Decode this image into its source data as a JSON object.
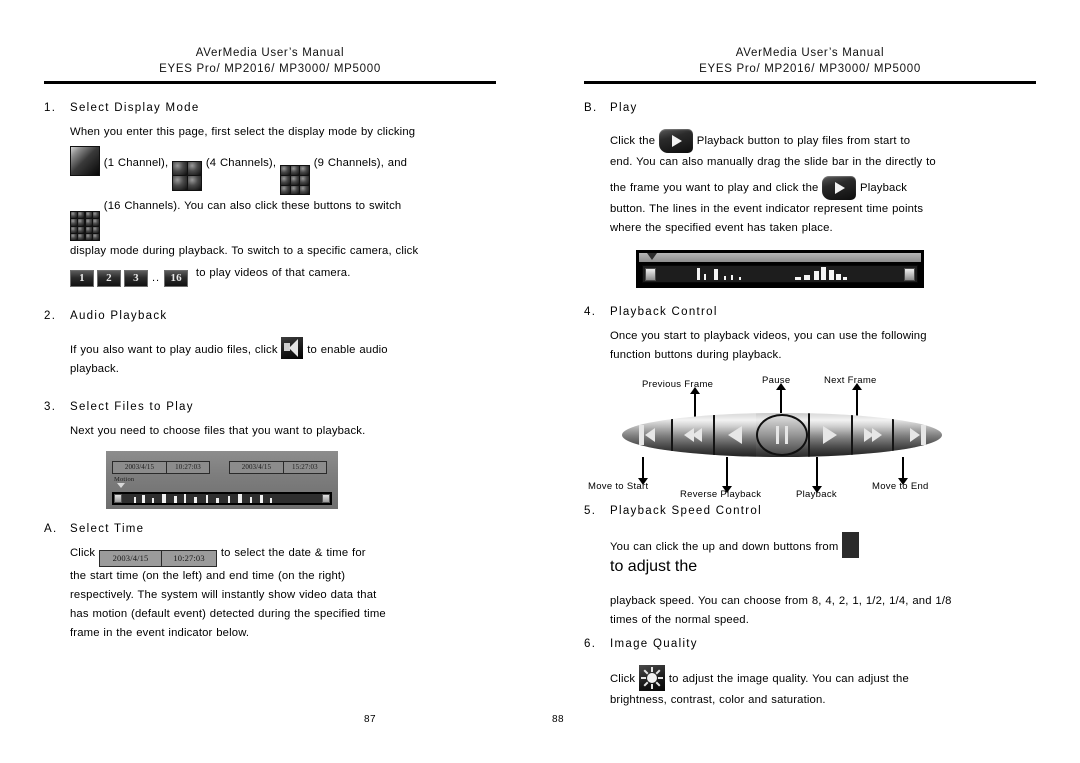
{
  "header": {
    "line1": "AVerMedia User’s Manual",
    "line2": "EYES Pro/ MP2016/ MP3000/ MP5000"
  },
  "left_page": {
    "page_number": "87",
    "sections": [
      {
        "marker": "1.",
        "heading": "Select Display Mode",
        "para1": "When you enter this page, first select the display mode by clicking",
        "label_1ch": "(1  Channel),",
        "label_4ch": "(4  Channels),",
        "label_9ch": "(9  Channels),  and",
        "label_16ch": "(16 Channels).   You  can  also  click  these  buttons  to  switch",
        "para2": "display  mode  during  playback.   To  switch  to  a  specific  camera,  click",
        "camera_buttons": [
          "1",
          "2",
          "3",
          "16"
        ],
        "camera_dots": "..",
        "para3": "to play videos of that camera."
      },
      {
        "marker": "2.",
        "heading": "Audio Playback",
        "para1_before": "If  you  also  want  to  play  audio  files,  click",
        "para1_after": "to  enable  audio",
        "para2": "playback."
      },
      {
        "marker": "3.",
        "heading": "Select Files to Play",
        "para1": "Next you need to choose files that you want to playback."
      }
    ],
    "files_screenshot": {
      "start_date": "2003/4/15",
      "start_time": "10:27:03",
      "end_date": "2003/4/15",
      "end_time": "15:27:03",
      "motion_label": "Motion"
    },
    "subsection": {
      "marker": "A.",
      "heading": "Select Time",
      "click_word": "Click",
      "chip_date": "2003/4/15",
      "chip_time": "10:27:03",
      "para_after": "to  select  the  date  &  time  for",
      "para2": "the  start  time  (on  the  left)  and  end  time  (on  the  right)",
      "para3": "respectively.   The  system  will  instantly  show  video  data  that",
      "para4": "has  motion  (default  event)  detected  during  the  specified  time",
      "para5": "frame in the event indicator below."
    }
  },
  "right_page": {
    "page_number": "88",
    "subsection_b": {
      "marker": "B.",
      "heading": "Play",
      "line1_before": "Click  the",
      "line1_after": "Playback  button  to  play  files  from  start  to",
      "line2": "end.  You can also manually drag the slide bar in the directly to",
      "line3_before": "the  frame  you  want  to  play  and  click  the",
      "line3_after": "Playback",
      "line4": "button.   The  lines  in  the  event  indicator  represent  time  points",
      "line5": "where the specified event has taken place."
    },
    "sections": [
      {
        "marker": "4.",
        "heading": "Playback Control",
        "para1": "Once  you  start  to  playback  videos,  you  can  use  the  following",
        "para2": "function buttons during playback."
      },
      {
        "marker": "5.",
        "heading": "Playback Speed Control",
        "para1_before": "You  can  click  the  up  and  down  buttons  from",
        "para1_after": "to  adjust  the",
        "para2": "playback  speed.   You  can  choose  from  8, 4, 2, 1, 1/2, 1/4, and 1/8",
        "para3": "times of the normal speed."
      },
      {
        "marker": "6.",
        "heading": "Image Quality",
        "para1_before": "Click",
        "para1_after": "to  adjust  the  image  quality.    You  can  adjust  the",
        "para2": "brightness, contrast, color and saturation."
      }
    ],
    "playback_control_diagram": {
      "top_labels": [
        "Previous Frame",
        "Pause",
        "Next Frame"
      ],
      "bottom_labels": [
        "Move to Start",
        "Reverse Playback",
        "Playback",
        "Move to End"
      ],
      "buttons": [
        "move-to-start",
        "reverse-playback",
        "previous-frame",
        "pause",
        "playback",
        "next-frame",
        "move-to-end"
      ]
    }
  },
  "colors": {
    "page_bg": "#ffffff",
    "text": "#000000",
    "rule": "#000000",
    "icon_dark": "#111111",
    "icon_light": "#e6e6e6",
    "screenshot_gray": "#8d8d8d"
  }
}
